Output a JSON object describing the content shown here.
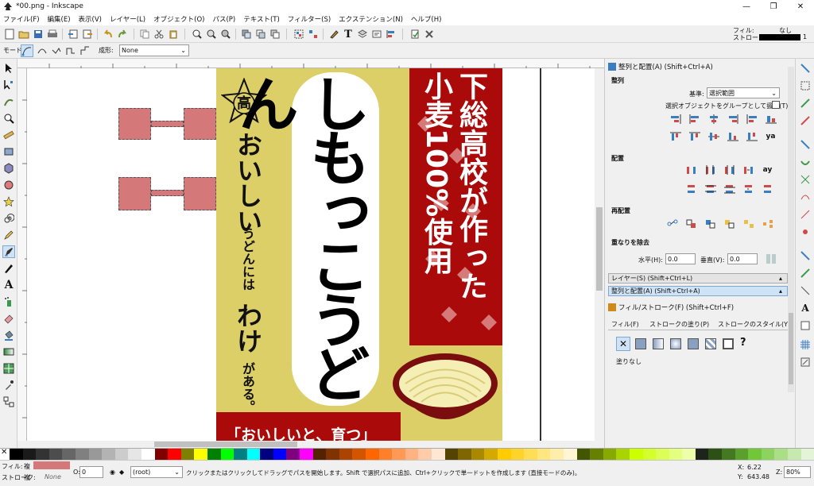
{
  "window": {
    "title": "*00.png - Inkscape"
  },
  "menu": [
    "ファイル(F)",
    "編集(E)",
    "表示(V)",
    "レイヤー(L)",
    "オブジェクト(O)",
    "パス(P)",
    "テキスト(T)",
    "フィルター(S)",
    "エクステンション(N)",
    "ヘルプ(H)"
  ],
  "toolbar_right": {
    "fill_label": "フィル:",
    "fill_value": "なし",
    "stroke_label": "ストローク:",
    "stroke_width": "1"
  },
  "control_bar": {
    "mode_label": "モード:",
    "shape_label": "成形:",
    "shape_value": "None"
  },
  "poster": {
    "title_vertical": "しもっこうどん",
    "tagline_chars": [
      "お",
      "い",
      "し",
      "い",
      "う",
      "ど",
      "ん",
      "に",
      "は",
      "わ",
      "け",
      "が",
      "あ",
      "る",
      "。"
    ],
    "tagline_big": "おいしい",
    "tagline_mid": "うどんには",
    "tagline_big2": "わけ",
    "tagline_end": "がある。",
    "red_col1": "下総高校が作った",
    "red_col2": "小麦100%使用",
    "emblem_char": "高",
    "bottom_banner": "「おいしいと、育つ」"
  },
  "align_panel": {
    "header": "整列と配置(A) (Shift+Ctrl+A)",
    "align_section": "整列",
    "relative_label": "基準:",
    "relative_value": "選択範囲",
    "group_label": "選択オブジェクトをグループとして扱う(T)",
    "distribute_section": "配置",
    "rearrange_section": "再配置",
    "overlap_section": "重なりを除去",
    "h_label": "水平(H):",
    "h_value": "0.0",
    "v_label": "垂直(V):",
    "v_value": "0.0"
  },
  "dock_tabs": [
    "レイヤー(S) (Shift+Ctrl+L)",
    "整列と配置(A) (Shift+Ctrl+A)"
  ],
  "fill_panel": {
    "header": "フィル/ストローク(F) (Shift+Ctrl+F)",
    "tabs": [
      "フィル(F)",
      "ストロークの塗り(P)",
      "ストロークのスタイル(Y)"
    ],
    "none_label": "塗りなし"
  },
  "status": {
    "fill_label": "フィル:",
    "fill_mark": "複",
    "stroke_label": "ストローク:",
    "stroke_mark": "複",
    "stroke_value": "None",
    "opacity_label": "O:",
    "opacity_value": "0",
    "layer_value": "(root)",
    "message": "クリックまたはクリックしてドラッグでパスを開始します。Shift で選択パスに追加、Ctrl+クリックで単一ドットを作成します (直接モードのみ)。",
    "x_label": "X:",
    "x_value": "6.22",
    "y_label": "Y:",
    "y_value": "643.48",
    "zoom_label": "Z:",
    "zoom_value": "80%"
  },
  "colors": {
    "poster_yellow": "#dccf67",
    "poster_red": "#aa0a0a",
    "bowl_red": "#7a0d0d",
    "selection_pink": "#d4787a",
    "accent_blue": "#3a7dc0"
  }
}
